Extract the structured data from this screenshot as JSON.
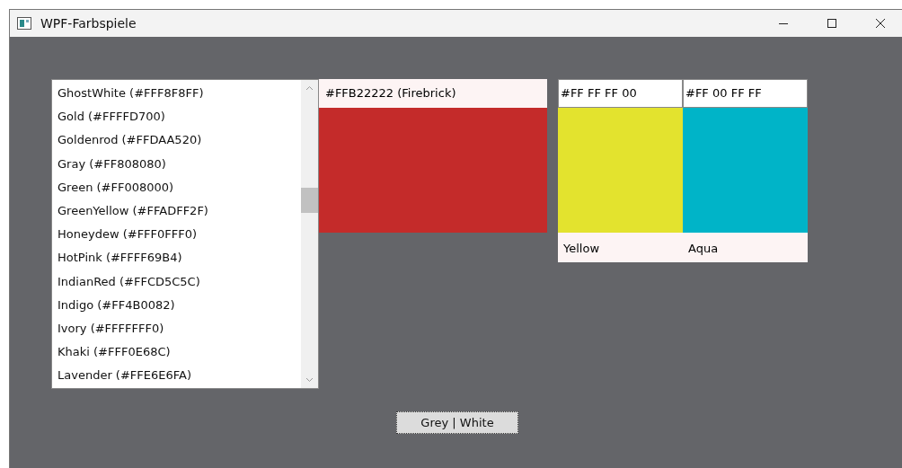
{
  "window": {
    "title": "WPF-Farbspiele"
  },
  "color_list": {
    "items": [
      {
        "label": "GhostWhite (#FFF8F8FF)"
      },
      {
        "label": "Gold (#FFFFD700)"
      },
      {
        "label": "Goldenrod (#FFDAA520)"
      },
      {
        "label": "Gray (#FF808080)"
      },
      {
        "label": "Green (#FF008000)"
      },
      {
        "label": "GreenYellow (#FFADFF2F)"
      },
      {
        "label": "Honeydew (#FFF0FFF0)"
      },
      {
        "label": "HotPink (#FFFF69B4)"
      },
      {
        "label": "IndianRed (#FFCD5C5C)"
      },
      {
        "label": "Indigo (#FF4B0082)"
      },
      {
        "label": "Ivory (#FFFFFFF0)"
      },
      {
        "label": "Khaki (#FFF0E68C)"
      },
      {
        "label": "Lavender (#FFE6E6FA)"
      }
    ]
  },
  "selected_swatch": {
    "header": "#FFB22222 (Firebrick)",
    "color": "#c42b2a"
  },
  "swatches": [
    {
      "hex": "#FF FF FF 00",
      "name": "Yellow",
      "color": "#e3e32e"
    },
    {
      "hex": "#FF 00 FF FF",
      "name": "Aqua",
      "color": "#00b4c8"
    }
  ],
  "toggle_button": {
    "label": "Grey | White"
  }
}
